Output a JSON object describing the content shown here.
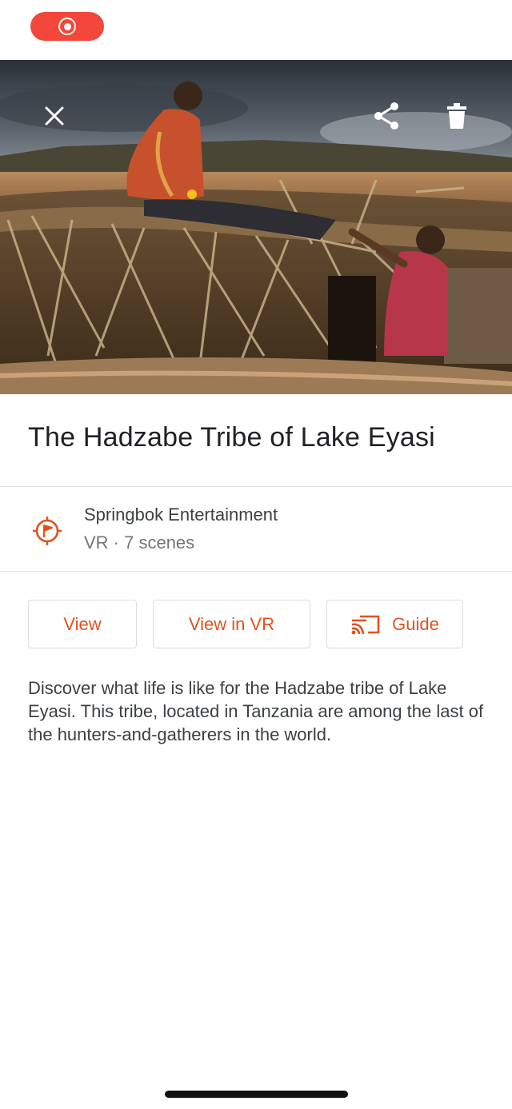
{
  "tour": {
    "title": "The Hadzabe Tribe of Lake Eyasi",
    "publisher": "Springbok Entertainment",
    "meta": "VR · 7 scenes",
    "description": "Discover what life is like for the Hadzabe tribe of Lake Eyasi. This tribe, located in Tanzania are among the last of the hunters-and-gatherers in the world."
  },
  "actions": {
    "view": "View",
    "view_vr": "View in VR",
    "guide": "Guide"
  },
  "icons": {
    "record": "screen-record-icon",
    "close": "close-icon",
    "share": "share-icon",
    "delete": "trash-icon",
    "publisher": "compass-flag-icon",
    "guide": "cast-guide-icon"
  },
  "colors": {
    "accent": "#e0531c",
    "record": "#f2473a"
  }
}
